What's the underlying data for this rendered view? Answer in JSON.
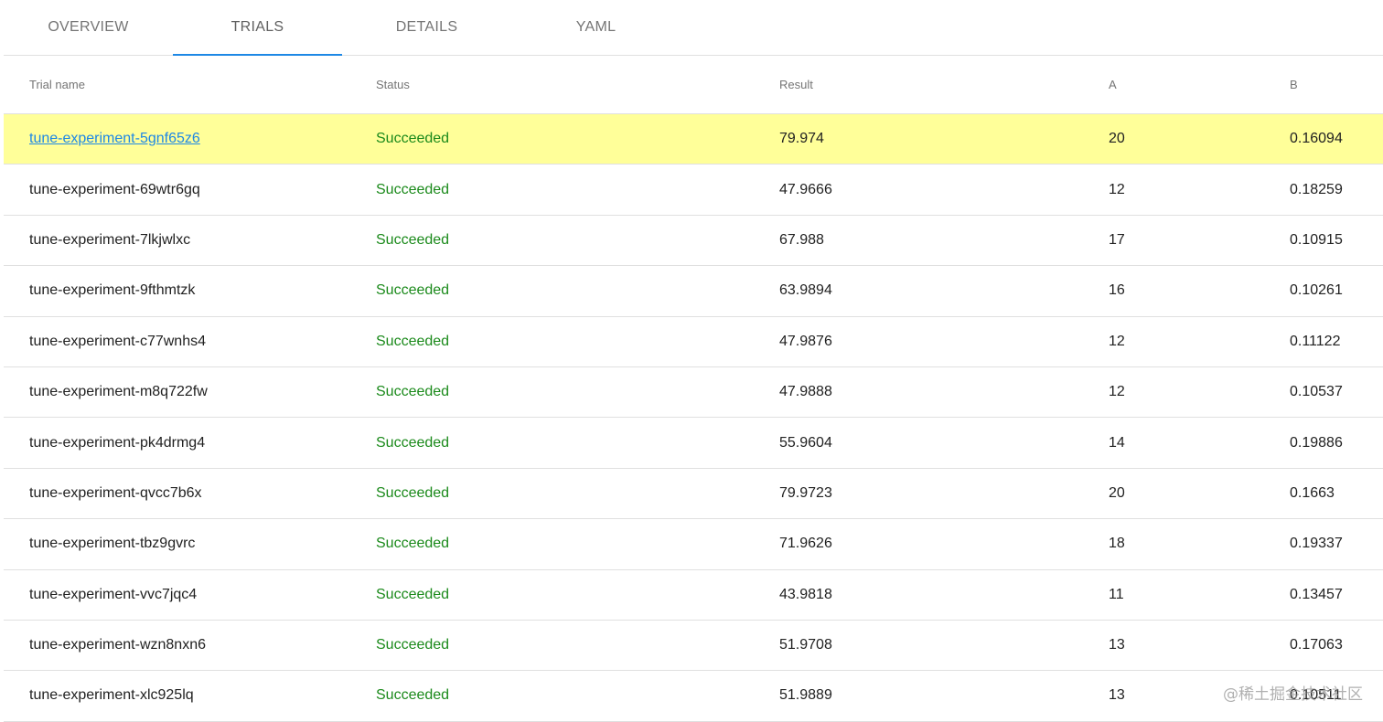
{
  "tabs": [
    "OVERVIEW",
    "TRIALS",
    "DETAILS",
    "YAML"
  ],
  "active_tab": "TRIALS",
  "table": {
    "headers": {
      "name": "Trial name",
      "status": "Status",
      "result": "Result",
      "a": "A",
      "b": "B"
    },
    "rows": [
      {
        "name": "tune-experiment-5gnf65z6",
        "status": "Succeeded",
        "result": "79.974",
        "a": "20",
        "b": "0.16094",
        "highlighted": true
      },
      {
        "name": "tune-experiment-69wtr6gq",
        "status": "Succeeded",
        "result": "47.9666",
        "a": "12",
        "b": "0.18259"
      },
      {
        "name": "tune-experiment-7lkjwlxc",
        "status": "Succeeded",
        "result": "67.988",
        "a": "17",
        "b": "0.10915"
      },
      {
        "name": "tune-experiment-9fthmtzk",
        "status": "Succeeded",
        "result": "63.9894",
        "a": "16",
        "b": "0.10261"
      },
      {
        "name": "tune-experiment-c77wnhs4",
        "status": "Succeeded",
        "result": "47.9876",
        "a": "12",
        "b": "0.11122"
      },
      {
        "name": "tune-experiment-m8q722fw",
        "status": "Succeeded",
        "result": "47.9888",
        "a": "12",
        "b": "0.10537"
      },
      {
        "name": "tune-experiment-pk4drmg4",
        "status": "Succeeded",
        "result": "55.9604",
        "a": "14",
        "b": "0.19886"
      },
      {
        "name": "tune-experiment-qvcc7b6x",
        "status": "Succeeded",
        "result": "79.9723",
        "a": "20",
        "b": "0.1663"
      },
      {
        "name": "tune-experiment-tbz9gvrc",
        "status": "Succeeded",
        "result": "71.9626",
        "a": "18",
        "b": "0.19337"
      },
      {
        "name": "tune-experiment-vvc7jqc4",
        "status": "Succeeded",
        "result": "43.9818",
        "a": "11",
        "b": "0.13457"
      },
      {
        "name": "tune-experiment-wzn8nxn6",
        "status": "Succeeded",
        "result": "51.9708",
        "a": "13",
        "b": "0.17063"
      },
      {
        "name": "tune-experiment-xlc925lq",
        "status": "Succeeded",
        "result": "51.9889",
        "a": "13",
        "b": "0.10511"
      }
    ]
  },
  "watermark": "@稀土掘金技术社区",
  "colors": {
    "accent": "#1e88e5",
    "success": "#1b8a1b",
    "highlight": "#ffff99"
  }
}
